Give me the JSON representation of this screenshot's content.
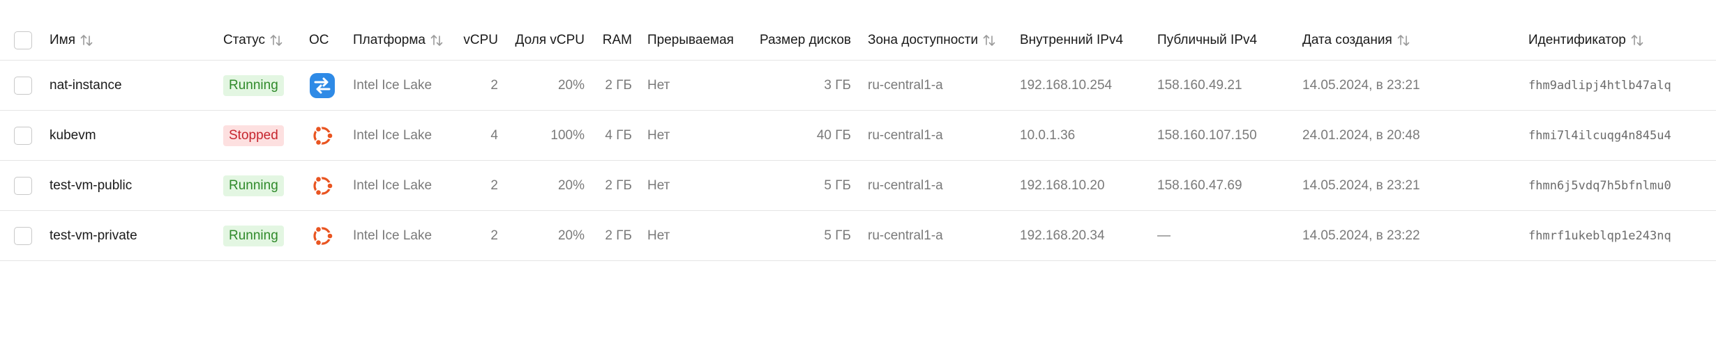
{
  "colors": {
    "running_bg": "#e3f6e2",
    "running_text": "#2f8a2a",
    "stopped_bg": "#fde0e0",
    "stopped_text": "#c6262e",
    "ubuntu": "#e95420",
    "nat_blue": "#2e8ae6"
  },
  "columns": {
    "name": "Имя",
    "status": "Статус",
    "os": "ОС",
    "platform": "Платформа",
    "vcpu": "vCPU",
    "vcpu_share": "Доля vCPU",
    "ram": "RAM",
    "preemptible": "Прерываемая",
    "disk_size": "Размер дисков",
    "zone": "Зона доступности",
    "internal_ip": "Внутренний IPv4",
    "public_ip": "Публичный IPv4",
    "created": "Дата создания",
    "id": "Идентификатор"
  },
  "rows": [
    {
      "name": "nat-instance",
      "status": "Running",
      "status_kind": "running",
      "os_icon": "nat-instance-icon",
      "platform": "Intel Ice Lake",
      "vcpu": "2",
      "vcpu_share": "20%",
      "ram": "2 ГБ",
      "preemptible": "Нет",
      "disk_size": "3 ГБ",
      "zone": "ru-central1-a",
      "internal_ip": "192.168.10.254",
      "public_ip": "158.160.49.21",
      "created": "14.05.2024, в 23:21",
      "id": "fhm9adlipj4htlb47alq"
    },
    {
      "name": "kubevm",
      "status": "Stopped",
      "status_kind": "stopped",
      "os_icon": "ubuntu-icon",
      "platform": "Intel Ice Lake",
      "vcpu": "4",
      "vcpu_share": "100%",
      "ram": "4 ГБ",
      "preemptible": "Нет",
      "disk_size": "40 ГБ",
      "zone": "ru-central1-a",
      "internal_ip": "10.0.1.36",
      "public_ip": "158.160.107.150",
      "created": "24.01.2024, в 20:48",
      "id": "fhmi7l4ilcuqg4n845u4"
    },
    {
      "name": "test-vm-public",
      "status": "Running",
      "status_kind": "running",
      "os_icon": "ubuntu-icon",
      "platform": "Intel Ice Lake",
      "vcpu": "2",
      "vcpu_share": "20%",
      "ram": "2 ГБ",
      "preemptible": "Нет",
      "disk_size": "5 ГБ",
      "zone": "ru-central1-a",
      "internal_ip": "192.168.10.20",
      "public_ip": "158.160.47.69",
      "created": "14.05.2024, в 23:21",
      "id": "fhmn6j5vdq7h5bfnlmu0"
    },
    {
      "name": "test-vm-private",
      "status": "Running",
      "status_kind": "running",
      "os_icon": "ubuntu-icon",
      "platform": "Intel Ice Lake",
      "vcpu": "2",
      "vcpu_share": "20%",
      "ram": "2 ГБ",
      "preemptible": "Нет",
      "disk_size": "5 ГБ",
      "zone": "ru-central1-a",
      "internal_ip": "192.168.20.34",
      "public_ip": "—",
      "created": "14.05.2024, в 23:22",
      "id": "fhmrf1ukeblqp1e243nq"
    }
  ]
}
